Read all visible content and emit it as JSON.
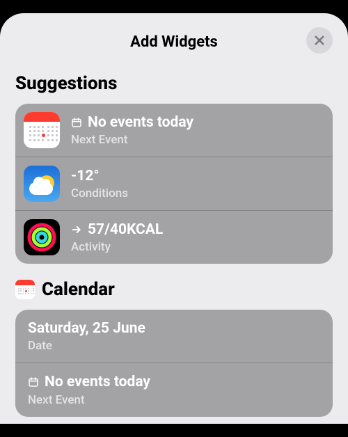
{
  "header": {
    "title": "Add Widgets"
  },
  "suggestions": {
    "title": "Suggestions",
    "items": [
      {
        "title": "No events today",
        "subtitle": "Next Event",
        "icon": "calendar",
        "inline_icon": "calendar-glyph"
      },
      {
        "title": "-12°",
        "subtitle": "Conditions",
        "icon": "weather"
      },
      {
        "title": "57/40KCAL",
        "subtitle": "Activity",
        "icon": "activity",
        "inline_icon": "arrow-right"
      }
    ]
  },
  "calendar": {
    "title": "Calendar",
    "items": [
      {
        "title": "Saturday, 25 June",
        "subtitle": "Date"
      },
      {
        "title": "No events today",
        "subtitle": "Next Event",
        "inline_icon": "calendar-glyph"
      }
    ]
  }
}
